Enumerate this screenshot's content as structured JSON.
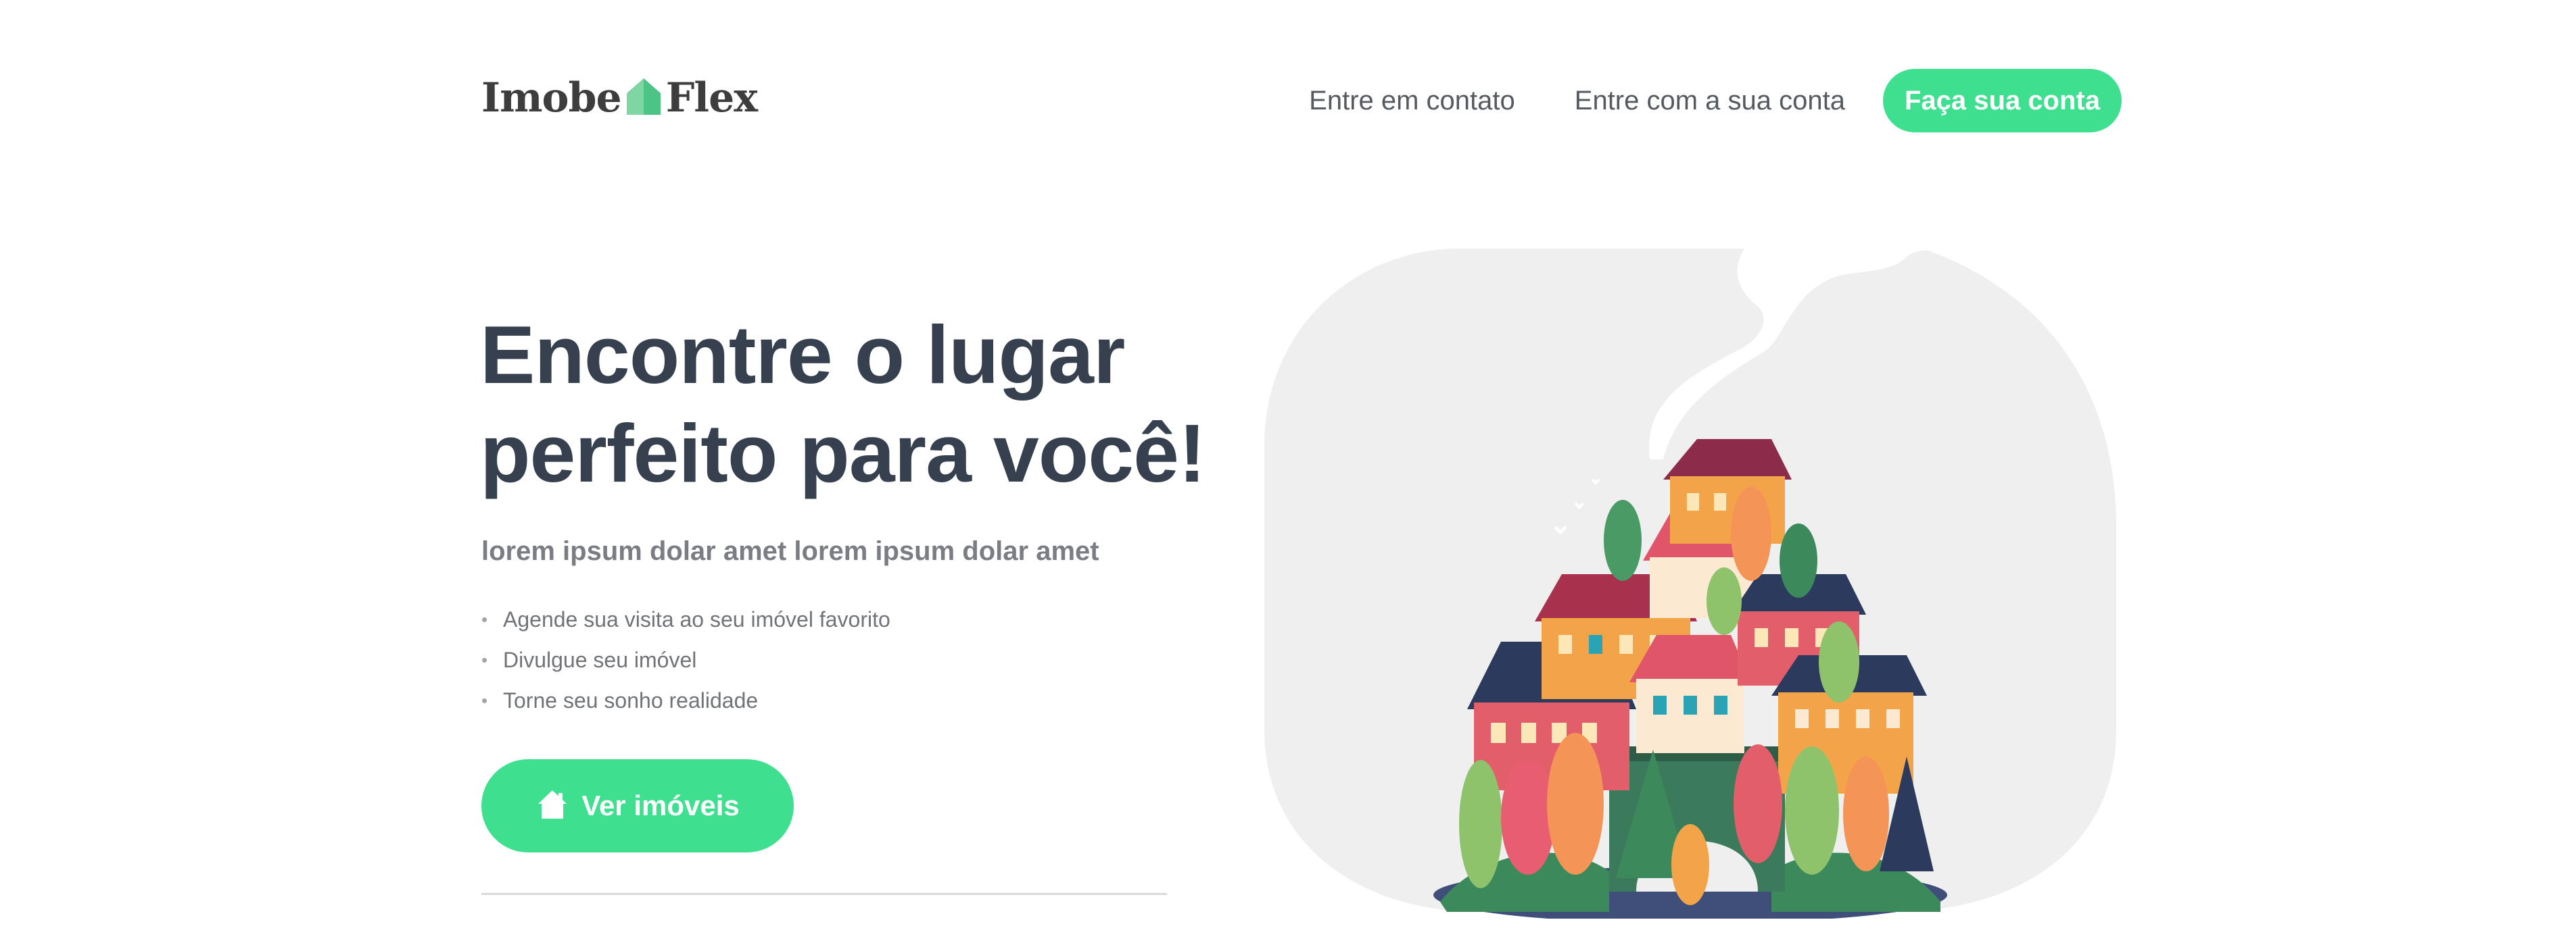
{
  "brand": {
    "part1": "Imobe",
    "part2": "Flex"
  },
  "nav": {
    "contact": "Entre em contato",
    "login": "Entre com a sua conta",
    "signup": "Faça sua conta"
  },
  "hero": {
    "title_line1": "Encontre o lugar",
    "title_line2": "perfeito para você!",
    "subtitle": "lorem ipsum dolar amet lorem ipsum dolar amet",
    "features": [
      "Agende sua visita ao seu imóvel favorito",
      "Divulgue seu imóvel",
      "Torne seu sonho realidade"
    ],
    "cta": "Ver imóveis"
  },
  "colors": {
    "accent": "#3ee08f",
    "title": "#36404f",
    "text": "#707378"
  }
}
